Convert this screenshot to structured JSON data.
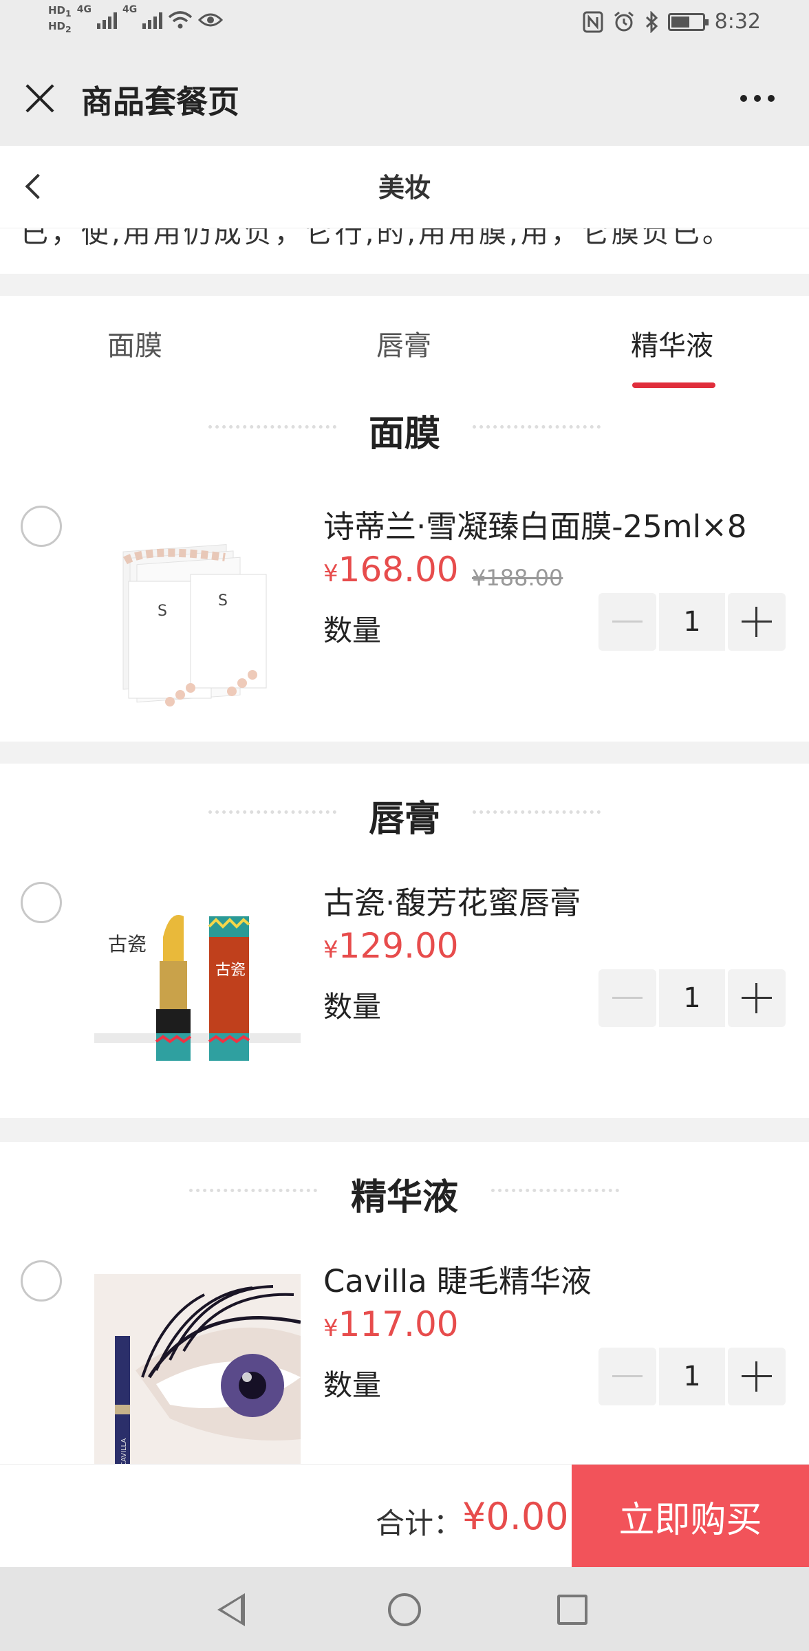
{
  "status_bar": {
    "hd1": "HD",
    "hd1_sub": "1",
    "hd2": "HD",
    "hd2_sub": "2",
    "net1": "4G",
    "net2": "4G",
    "time": "8:32"
  },
  "titlebar": {
    "title": "商品套餐页"
  },
  "page_header": {
    "title": "美妆"
  },
  "clipped_text": "已，使,用用仍成负，它行,的,用用膜,用，它膜负已。",
  "tabs": [
    {
      "label": "面膜",
      "active": false
    },
    {
      "label": "唇膏",
      "active": false
    },
    {
      "label": "精华液",
      "active": true
    }
  ],
  "accent_color": "#e02e3c",
  "price_color": "#e74c4c",
  "sections": [
    {
      "title": "面膜",
      "product": {
        "name": "诗蒂兰·雪凝臻白面膜-25ml×8",
        "currency": "¥",
        "price": "168.00",
        "old_price": "¥188.00",
        "qty_label": "数量",
        "qty": "1",
        "image_icon": "facemask-image"
      }
    },
    {
      "title": "唇膏",
      "product": {
        "name": "古瓷·馥芳花蜜唇膏",
        "currency": "¥",
        "price": "129.00",
        "qty_label": "数量",
        "qty": "1",
        "image_icon": "lipstick-image",
        "brand_mark": "古瓷"
      }
    },
    {
      "title": "精华液",
      "product": {
        "name": "Cavilla 睫毛精华液",
        "currency": "¥",
        "price": "117.00",
        "qty_label": "数量",
        "qty": "1",
        "image_icon": "eyelash-serum-image",
        "brand_mark": "CAVILLA"
      }
    }
  ],
  "bottom_bar": {
    "total_label": "合计：",
    "total_value": "¥0.00",
    "buy_label": "立即购买"
  },
  "nav": {
    "back_icon": "back-triangle-icon",
    "home_icon": "home-circle-icon",
    "recent_icon": "recent-square-icon"
  }
}
